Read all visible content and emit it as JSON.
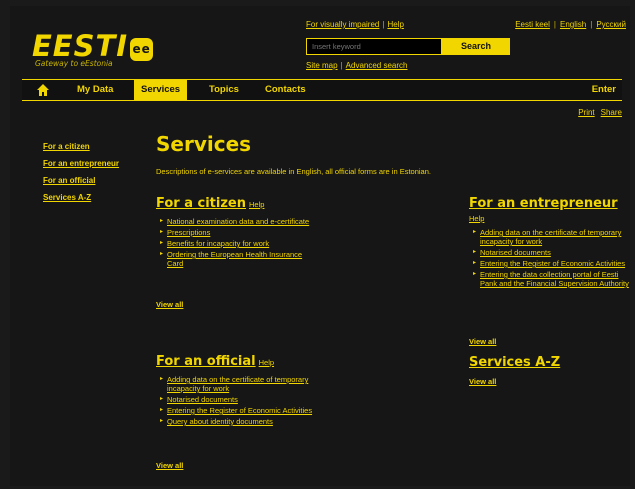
{
  "header": {
    "logo_text": "EESTI",
    "logo_badge": "ee",
    "logo_tagline": "Gateway to eEstonia",
    "top_links": [
      "For visually impaired",
      "Help"
    ],
    "languages": [
      "Eesti keel",
      "English",
      "Русский"
    ],
    "search": {
      "placeholder": "Insert keyword",
      "button": "Search"
    },
    "sub_links": [
      "Site map",
      "Advanced search"
    ]
  },
  "nav": {
    "items": [
      "My Data",
      "Services",
      "Topics",
      "Contacts"
    ],
    "active": "Services",
    "enter": "Enter"
  },
  "tools": {
    "print": "Print",
    "share": "Share"
  },
  "sidebar": {
    "items": [
      "For a citizen",
      "For an entrepreneur",
      "For an official",
      "Services A-Z"
    ]
  },
  "main": {
    "title": "Services",
    "intro": "Descriptions of e-services are available in English, all official forms are in Estonian."
  },
  "sections": {
    "citizen": {
      "title": "For a citizen",
      "help": "Help",
      "items": [
        "National examination data and e-certificate",
        "Prescriptions",
        "Benefits for incapacity for work",
        "Ordering the European Health Insurance Card"
      ],
      "view_all": "View all"
    },
    "entrepreneur": {
      "title": "For an entrepreneur",
      "help": "Help",
      "items": [
        "Adding data on the certificate of temporary incapacity for work",
        "Notarised documents",
        "Entering the Register of Economic Activities",
        "Entering the data collection portal of Eesti Pank and the Financial Supervision Authority"
      ],
      "view_all": "View all"
    },
    "official": {
      "title": "For an official",
      "help": "Help",
      "items": [
        "Adding data on the certificate of temporary incapacity for work",
        "Notarised documents",
        "Entering the Register of Economic Activities",
        "Query about identity documents"
      ],
      "view_all": "View all"
    },
    "az": {
      "title": "Services A-Z",
      "view_all": "View all"
    }
  },
  "colors": {
    "accent": "#f2d600",
    "background": "#161616"
  }
}
